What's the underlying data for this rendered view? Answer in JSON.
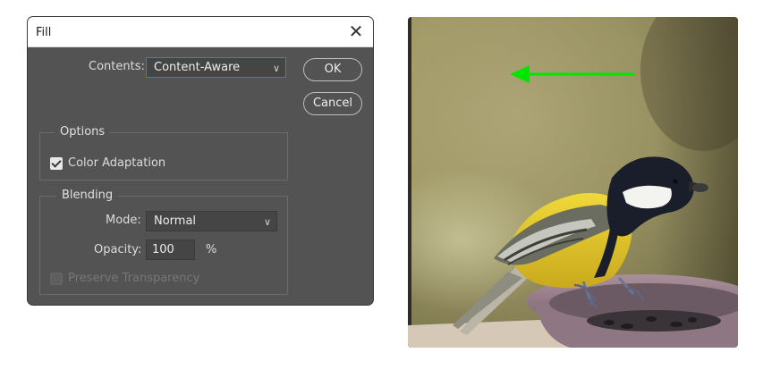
{
  "dialog": {
    "title": "Fill",
    "contents_label": "Contents:",
    "contents_value": "Content-Aware",
    "ok_label": "OK",
    "cancel_label": "Cancel",
    "options": {
      "title": "Options",
      "color_adaptation_label": "Color Adaptation",
      "color_adaptation_checked": true
    },
    "blending": {
      "title": "Blending",
      "mode_label": "Mode:",
      "mode_value": "Normal",
      "opacity_label": "Opacity:",
      "opacity_value": "100",
      "opacity_unit": "%",
      "preserve_transparency_label": "Preserve Transparency",
      "preserve_transparency_checked": false,
      "preserve_transparency_enabled": false
    }
  },
  "photo": {
    "subject": "great tit on a seed feeder",
    "arrow_color": "#00e600",
    "arrow_direction": "left"
  },
  "colors": {
    "dialog_bg": "#535353",
    "field_bg": "#454545",
    "focus_border": "#3d7cc9"
  }
}
